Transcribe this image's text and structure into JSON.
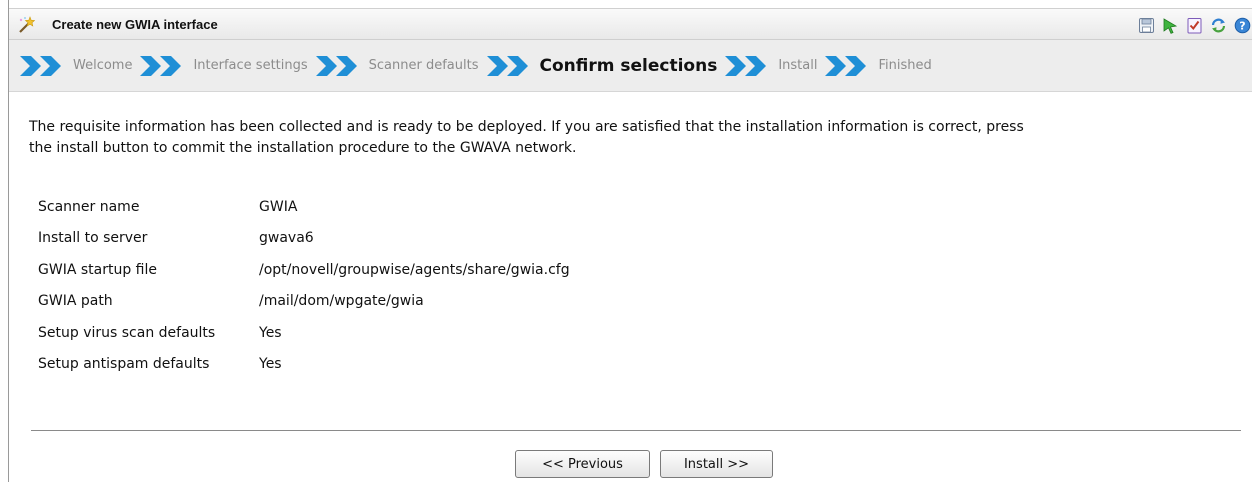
{
  "window": {
    "title": "Create new GWIA interface",
    "toolbar_icons": [
      "save-icon",
      "run-icon",
      "checklist-icon",
      "refresh-icon",
      "help-icon"
    ]
  },
  "steps": [
    {
      "label": "Welcome",
      "active": false
    },
    {
      "label": "Interface settings",
      "active": false
    },
    {
      "label": "Scanner defaults",
      "active": false
    },
    {
      "label": "Confirm selections",
      "active": true
    },
    {
      "label": "Install",
      "active": false
    },
    {
      "label": "Finished",
      "active": false
    }
  ],
  "intro": {
    "line1": "The requisite information has been collected and is ready to be deployed. If you are satisfied that the installation information is correct, press",
    "line2": "the install button to commit the installation procedure to the GWAVA network."
  },
  "details": [
    {
      "label": "Scanner name",
      "value": "GWIA"
    },
    {
      "label": "Install to server",
      "value": "gwava6"
    },
    {
      "label": "GWIA startup file",
      "value": "/opt/novell/groupwise/agents/share/gwia.cfg"
    },
    {
      "label": "GWIA path",
      "value": "/mail/dom/wpgate/gwia"
    },
    {
      "label": "Setup virus scan defaults",
      "value": "Yes"
    },
    {
      "label": "Setup antispam defaults",
      "value": "Yes"
    }
  ],
  "buttons": {
    "previous": "<< Previous",
    "install": "Install >>"
  },
  "colors": {
    "step_arrow": "#1f8fd6",
    "step_bar": "#ededed"
  }
}
